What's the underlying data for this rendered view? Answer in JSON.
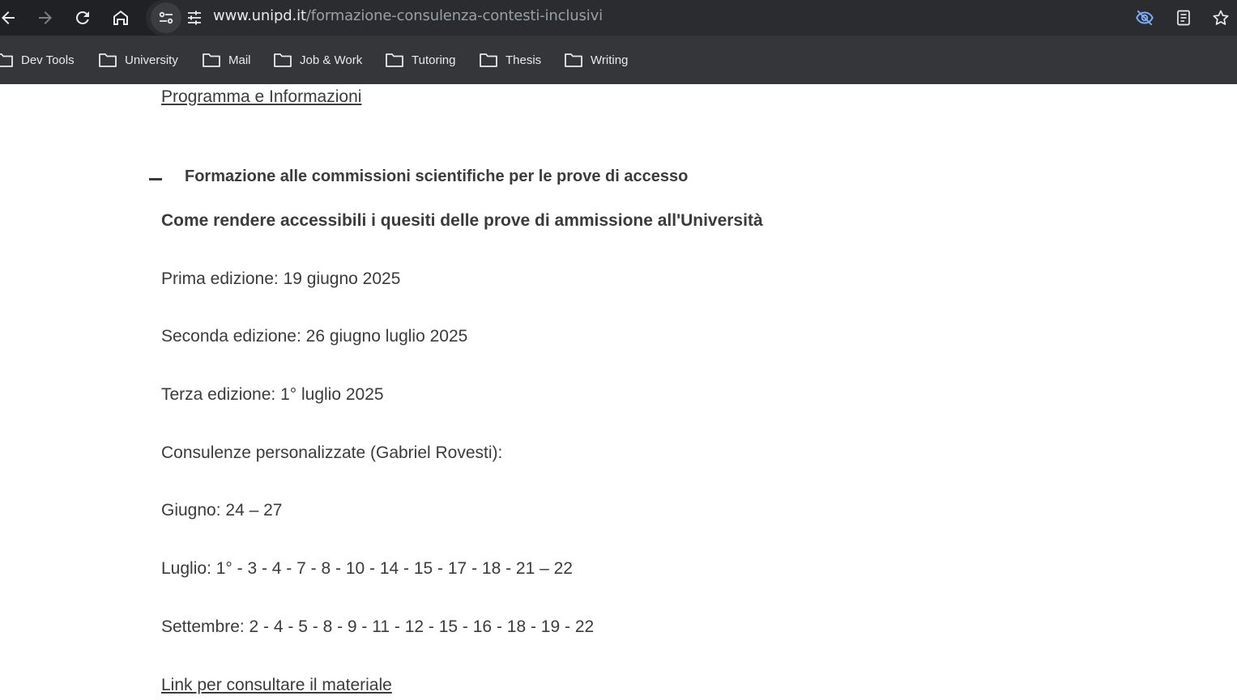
{
  "browser": {
    "url_domain": "www.unipd.it",
    "url_path": "/formazione-consulenza-contesti-inclusivi",
    "bookmarks": [
      {
        "label": "Dev Tools"
      },
      {
        "label": "University"
      },
      {
        "label": "Mail"
      },
      {
        "label": "Job & Work"
      },
      {
        "label": "Tutoring"
      },
      {
        "label": "Thesis"
      },
      {
        "label": "Writing"
      }
    ]
  },
  "page": {
    "top_link": "Programma e Informazioni",
    "accordion_title": "Formazione alle commissioni scientifiche per le prove di accesso",
    "subtitle": "Come rendere accessibili i quesiti delle prove di ammissione all'Università",
    "lines": [
      "Prima edizione: 19 giugno 2025",
      "Seconda edizione: 26 giugno luglio 2025",
      "Terza edizione: 1° luglio 2025",
      "Consulenze personalizzate (Gabriel Rovesti):",
      "Giugno: 24 – 27",
      "Luglio: 1° - 3 - 4 - 7 - 8 - 10 - 14 - 15 - 17 - 18 - 21 – 22",
      "Settembre: 2 - 4 - 5 - 8 - 9 - 11 - 12 - 15 - 16 - 18 - 19 - 22"
    ],
    "bottom_link": "Link per consultare il materiale"
  }
}
